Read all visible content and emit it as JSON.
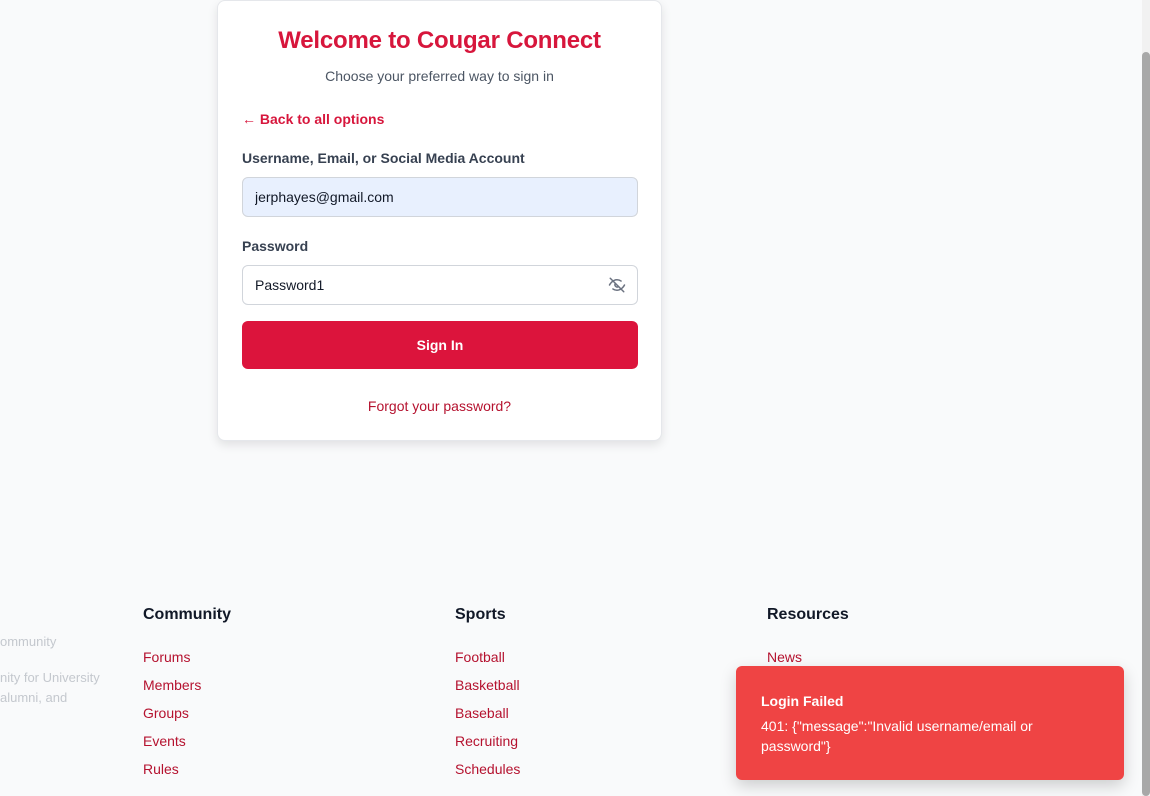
{
  "login_card": {
    "title": "Welcome to Cougar Connect",
    "subtitle": "Choose your preferred way to sign in",
    "back_link": "← Back to all options",
    "username_label": "Username, Email, or Social Media Account",
    "username_value": "jerphayes@gmail.com",
    "password_label": "Password",
    "password_value": "Password1",
    "password_toggle_icon": "eye-off-icon",
    "sign_in_label": "Sign In",
    "forgot_link": "Forgot your password?"
  },
  "footer": {
    "about_fragments": [
      "ommunity",
      "nity for University",
      "alumni, and"
    ],
    "columns": [
      {
        "heading": "Community",
        "links": [
          "Forums",
          "Members",
          "Groups",
          "Events",
          "Rules"
        ]
      },
      {
        "heading": "Sports",
        "links": [
          "Football",
          "Basketball",
          "Baseball",
          "Recruiting",
          "Schedules"
        ]
      },
      {
        "heading": "Resources",
        "links": [
          "News"
        ]
      }
    ]
  },
  "toast": {
    "title": "Login Failed",
    "message": "401: {\"message\":\"Invalid username/email or password\"}"
  },
  "colors": {
    "brand_red": "#dc143c",
    "link_red": "#b5122f",
    "toast_red": "#ef4444",
    "autofill_blue": "#e8f0fe"
  }
}
